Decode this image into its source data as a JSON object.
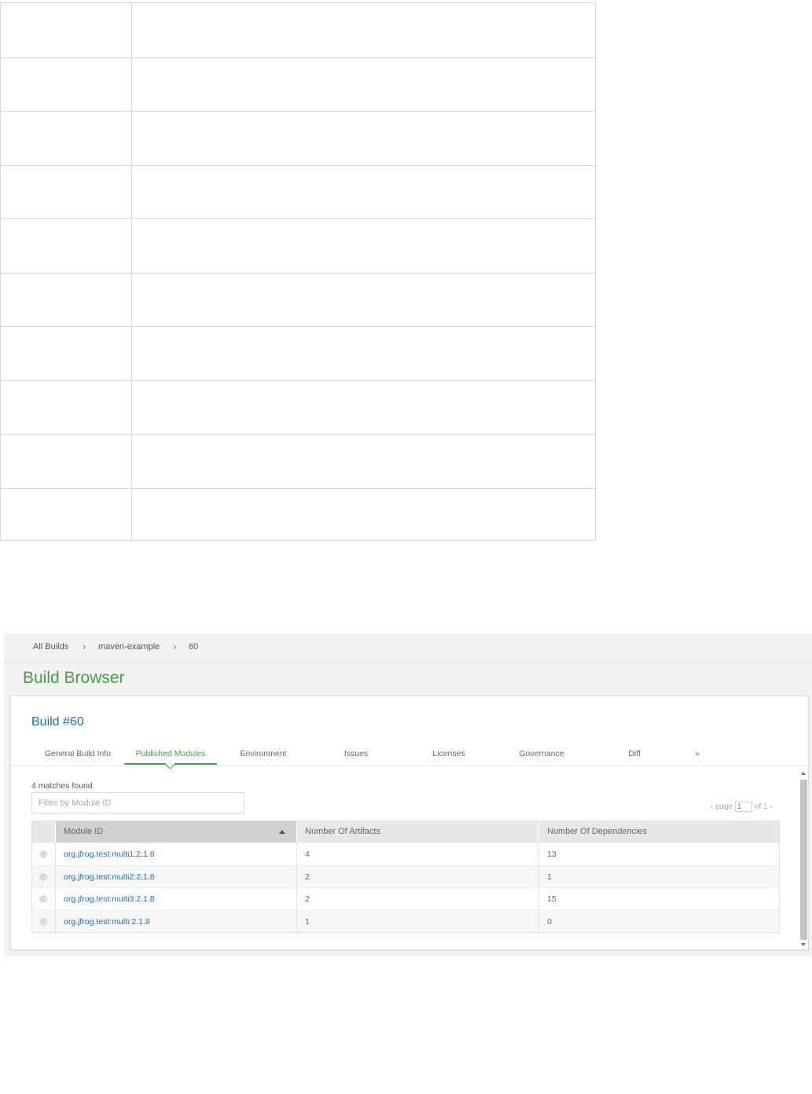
{
  "breadcrumb": {
    "items": [
      "All Builds",
      "maven-example",
      "60"
    ],
    "separator": "›"
  },
  "page_title": "Build Browser",
  "build_title": "Build #60",
  "tabs": [
    {
      "label": "General Build Info",
      "active": false
    },
    {
      "label": "Published Modules",
      "active": true
    },
    {
      "label": "Environment",
      "active": false
    },
    {
      "label": "Issues",
      "active": false
    },
    {
      "label": "Licenses",
      "active": false
    },
    {
      "label": "Governance",
      "active": false
    },
    {
      "label": "Diff",
      "active": false
    },
    {
      "label": "»",
      "active": false
    }
  ],
  "matches_text": "4 matches found",
  "filter": {
    "placeholder": "Filter by Module ID",
    "value": ""
  },
  "pager": {
    "prefix": "‹ page",
    "page": "1",
    "suffix": "of 1 ›"
  },
  "table": {
    "columns": [
      "Module ID",
      "Number Of Artifacts",
      "Number Of Dependencies"
    ],
    "sorted_column": "Module ID",
    "sort_direction": "ascending",
    "rows": [
      {
        "module_id": "org.jfrog.test:multi1:2.1.8",
        "artifacts": "4",
        "dependencies": "13"
      },
      {
        "module_id": "org.jfrog.test:multi2:2.1.8",
        "artifacts": "2",
        "dependencies": "1"
      },
      {
        "module_id": "org.jfrog.test:multi3:2.1.8",
        "artifacts": "2",
        "dependencies": "15"
      },
      {
        "module_id": "org.jfrog.test:multi:2.1.8",
        "artifacts": "1",
        "dependencies": "0"
      }
    ]
  },
  "colors": {
    "accent_green": "#43a047",
    "link_blue": "#1e6fb5"
  }
}
